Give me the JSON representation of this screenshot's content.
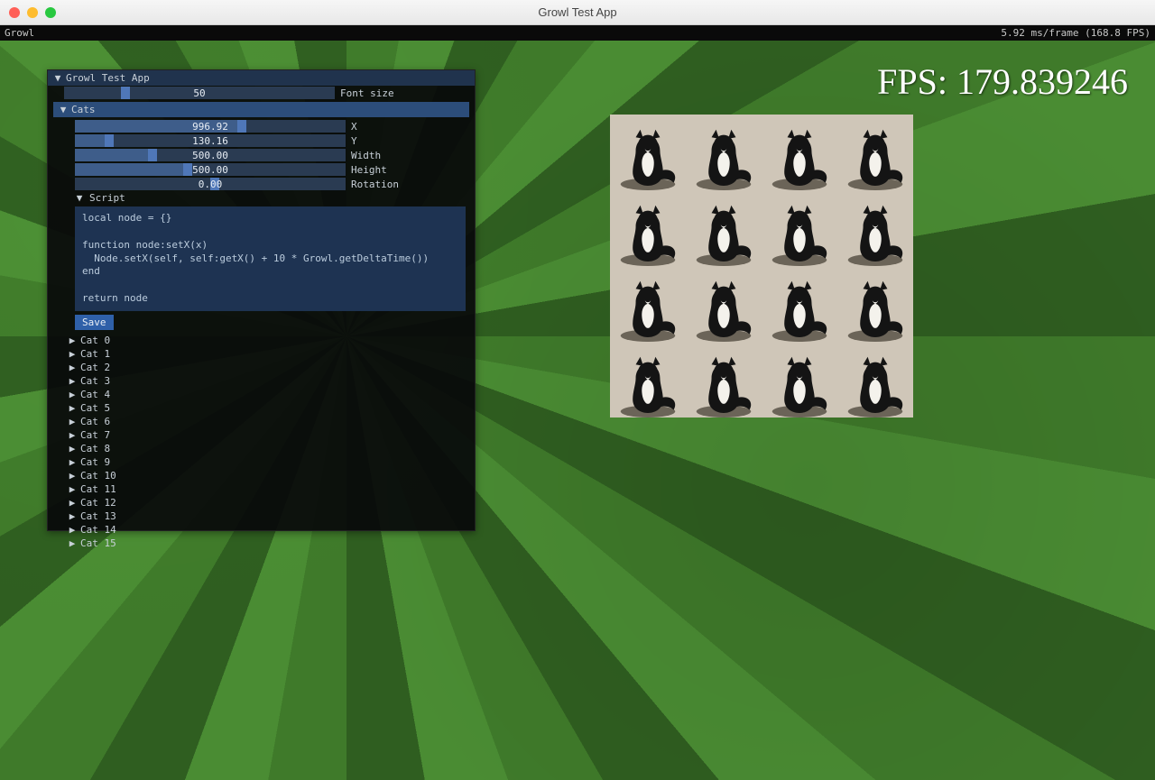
{
  "window": {
    "title": "Growl Test App",
    "menu_left": "Growl",
    "perf_text": "5.92 ms/frame (168.8 FPS)"
  },
  "overlay": {
    "fps_label": "FPS: 179.839246"
  },
  "panel": {
    "title": "Growl Test App",
    "font_slider": {
      "label": "Font size",
      "value": "50",
      "thumb_pct": 21
    },
    "cats_header": "Cats",
    "props": [
      {
        "key": "x",
        "label": "X",
        "value": "996.92",
        "thumb_pct": 60,
        "fill_pct": 62
      },
      {
        "key": "y",
        "label": "Y",
        "value": "130.16",
        "thumb_pct": 11,
        "fill_pct": 13
      },
      {
        "key": "width",
        "label": "Width",
        "value": "500.00",
        "thumb_pct": 27,
        "fill_pct": 29
      },
      {
        "key": "height",
        "label": "Height",
        "value": "500.00",
        "thumb_pct": 40,
        "fill_pct": 42
      },
      {
        "key": "rotation",
        "label": "Rotation",
        "value": "0.00",
        "thumb_pct": 50,
        "fill_pct": 0
      }
    ],
    "script_header": "Script",
    "script_body": "local node = {}\n\nfunction node:setX(x)\n  Node.setX(self, self:getX() + 10 * Growl.getDeltaTime())\nend\n\nreturn node",
    "save_label": "Save",
    "nodes": [
      "Cat 0",
      "Cat 1",
      "Cat 2",
      "Cat 3",
      "Cat 4",
      "Cat 5",
      "Cat 6",
      "Cat 7",
      "Cat 8",
      "Cat 9",
      "Cat 10",
      "Cat 11",
      "Cat 12",
      "Cat 13",
      "Cat 14",
      "Cat 15"
    ]
  },
  "cat_grid": {
    "rows": 4,
    "cols": 4
  }
}
